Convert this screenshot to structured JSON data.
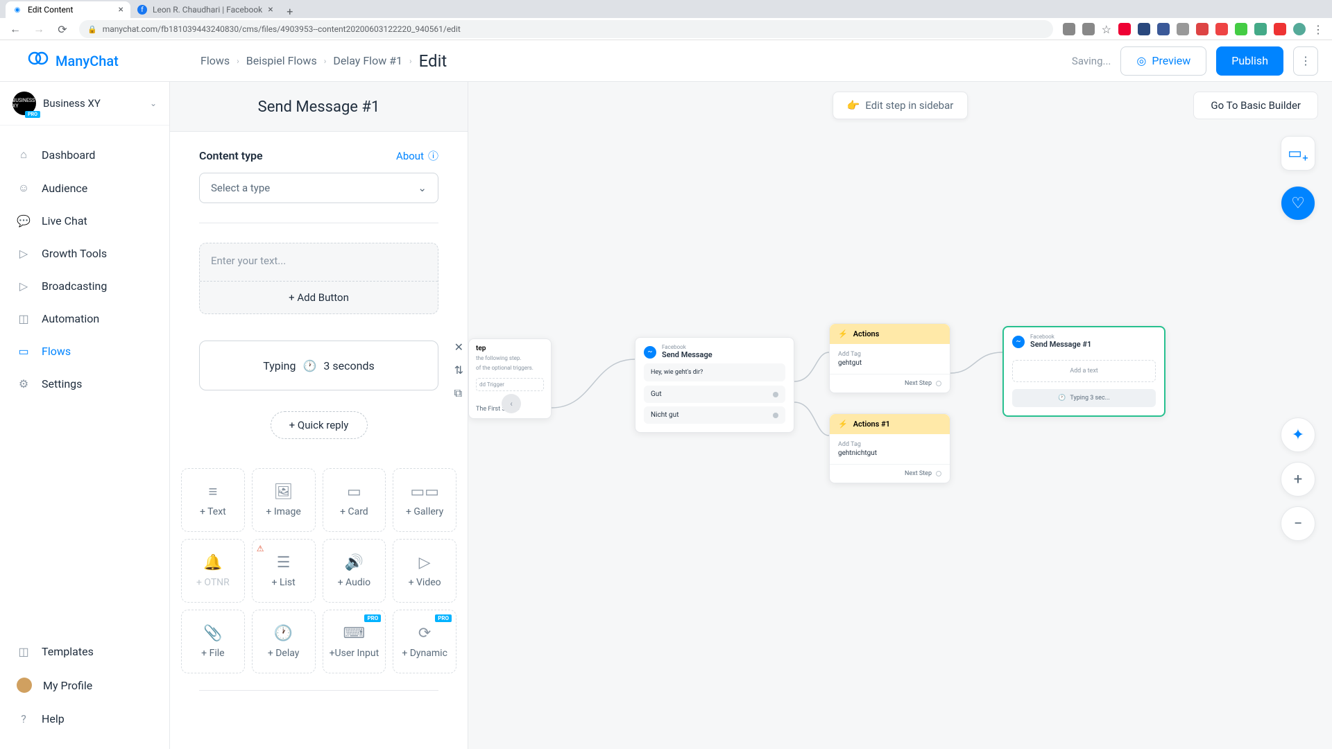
{
  "browser": {
    "tabs": [
      {
        "title": "Edit Content",
        "active": true
      },
      {
        "title": "Leon R. Chaudhari | Facebook",
        "active": false
      }
    ],
    "url": "manychat.com/fb181039443240830/cms/files/4903953--content20200603122220_940561/edit"
  },
  "brand": {
    "name": "ManyChat"
  },
  "breadcrumbs": {
    "items": [
      "Flows",
      "Beispiel Flows",
      "Delay Flow #1"
    ],
    "current": "Edit"
  },
  "header": {
    "saving": "Saving...",
    "preview": "Preview",
    "publish": "Publish"
  },
  "workspace": {
    "name": "Business XY",
    "badge": "PRO",
    "avatar": "BUSINESS XY"
  },
  "nav": {
    "items": [
      {
        "label": "Dashboard"
      },
      {
        "label": "Audience"
      },
      {
        "label": "Live Chat"
      },
      {
        "label": "Growth Tools"
      },
      {
        "label": "Broadcasting"
      },
      {
        "label": "Automation"
      },
      {
        "label": "Flows",
        "active": true
      },
      {
        "label": "Settings"
      }
    ],
    "bottom": [
      {
        "label": "Templates"
      },
      {
        "label": "My Profile"
      },
      {
        "label": "Help"
      }
    ]
  },
  "editor": {
    "title": "Send Message #1",
    "content_type_label": "Content type",
    "about": "About",
    "select_placeholder": "Select a type",
    "text_placeholder": "Enter your text...",
    "add_button": "+ Add Button",
    "typing_label": "Typing",
    "typing_duration": "3 seconds",
    "quick_reply": "+ Quick reply",
    "tiles": [
      {
        "label": "+ Text"
      },
      {
        "label": "+ Image"
      },
      {
        "label": "+ Card"
      },
      {
        "label": "+ Gallery"
      },
      {
        "label": "+ OTNR",
        "disabled": true
      },
      {
        "label": "+ List",
        "warn": true
      },
      {
        "label": "+ Audio"
      },
      {
        "label": "+ Video"
      },
      {
        "label": "+ File"
      },
      {
        "label": "+ Delay"
      },
      {
        "label": "+User Input",
        "pro": true
      },
      {
        "label": "+ Dynamic",
        "pro": true
      }
    ]
  },
  "canvas": {
    "edit_step": "Edit step in sidebar",
    "basic_builder": "Go To Basic Builder",
    "partial": {
      "title": "tep",
      "hint1": "the following step.",
      "hint2": "of the optional triggers.",
      "add_trigger": "dd Trigger",
      "first_step": "The First Step"
    },
    "send_node": {
      "src": "Facebook",
      "title": "Send Message",
      "msg": "Hey, wie geht's dir?",
      "opt1": "Gut",
      "opt2": "Nicht gut"
    },
    "actions1": {
      "title": "Actions",
      "add_label": "Add Tag",
      "add_value": "gehtgut",
      "next": "Next Step"
    },
    "actions2": {
      "title": "Actions #1",
      "add_label": "Add Tag",
      "add_value": "gehtnichtgut",
      "next": "Next Step"
    },
    "send1": {
      "src": "Facebook",
      "title": "Send Message #1",
      "placeholder": "Add a text",
      "typing": "Typing 3 sec..."
    }
  },
  "pro": "PRO"
}
